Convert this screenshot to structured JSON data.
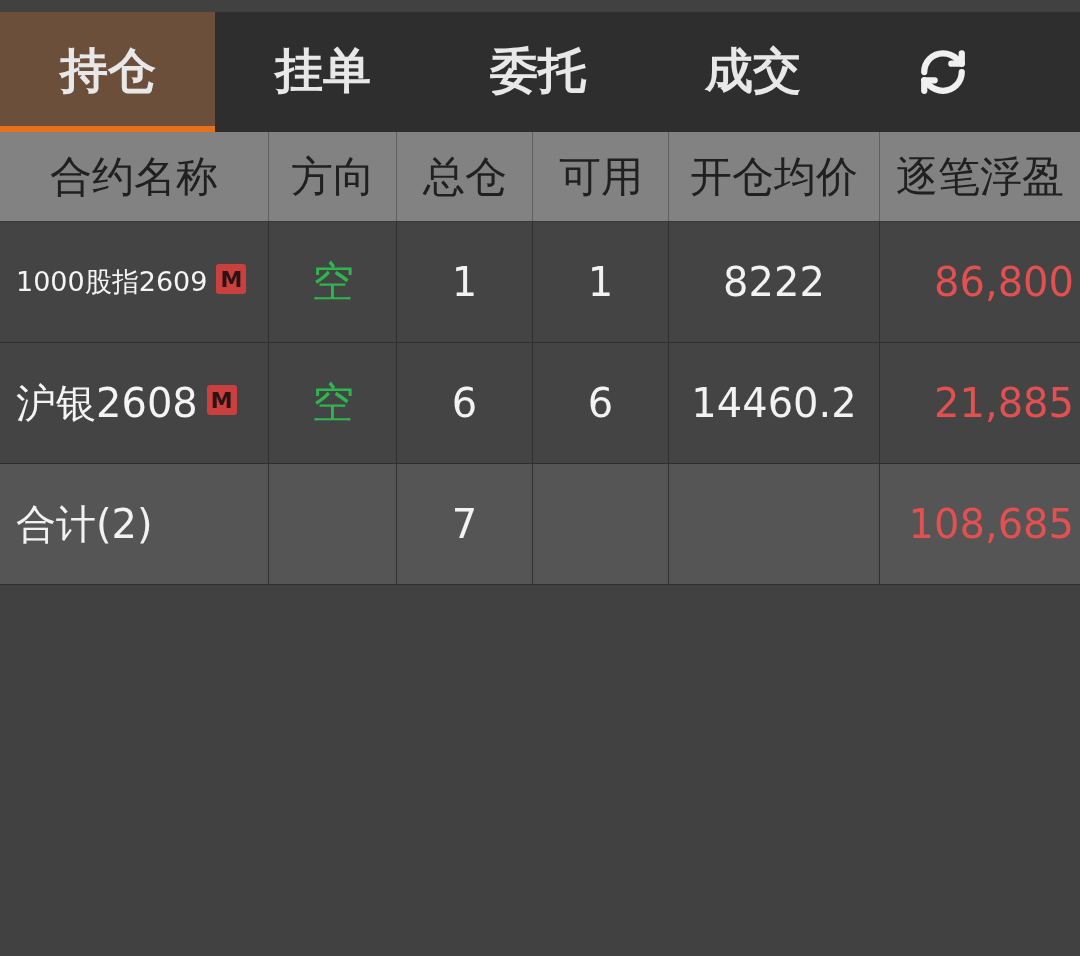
{
  "tabs": [
    {
      "label": "持仓",
      "selected": true
    },
    {
      "label": "挂单",
      "selected": false
    },
    {
      "label": "委托",
      "selected": false
    },
    {
      "label": "成交",
      "selected": false
    }
  ],
  "table": {
    "columns": [
      "合约名称",
      "方向",
      "总仓",
      "可用",
      "开仓均价",
      "逐笔浮盈"
    ],
    "rows": [
      {
        "name": "1000股指2609",
        "tag": "M",
        "direction": "空",
        "total": "1",
        "available": "1",
        "avg_price": "8222",
        "pnl": "86,800"
      },
      {
        "name": "沪银2608",
        "tag": "M",
        "direction": "空",
        "total": "6",
        "available": "6",
        "avg_price": "14460.2",
        "pnl": "21,885"
      }
    ],
    "total_row": {
      "label": "合计(2)",
      "total": "7",
      "pnl": "108,685"
    }
  }
}
